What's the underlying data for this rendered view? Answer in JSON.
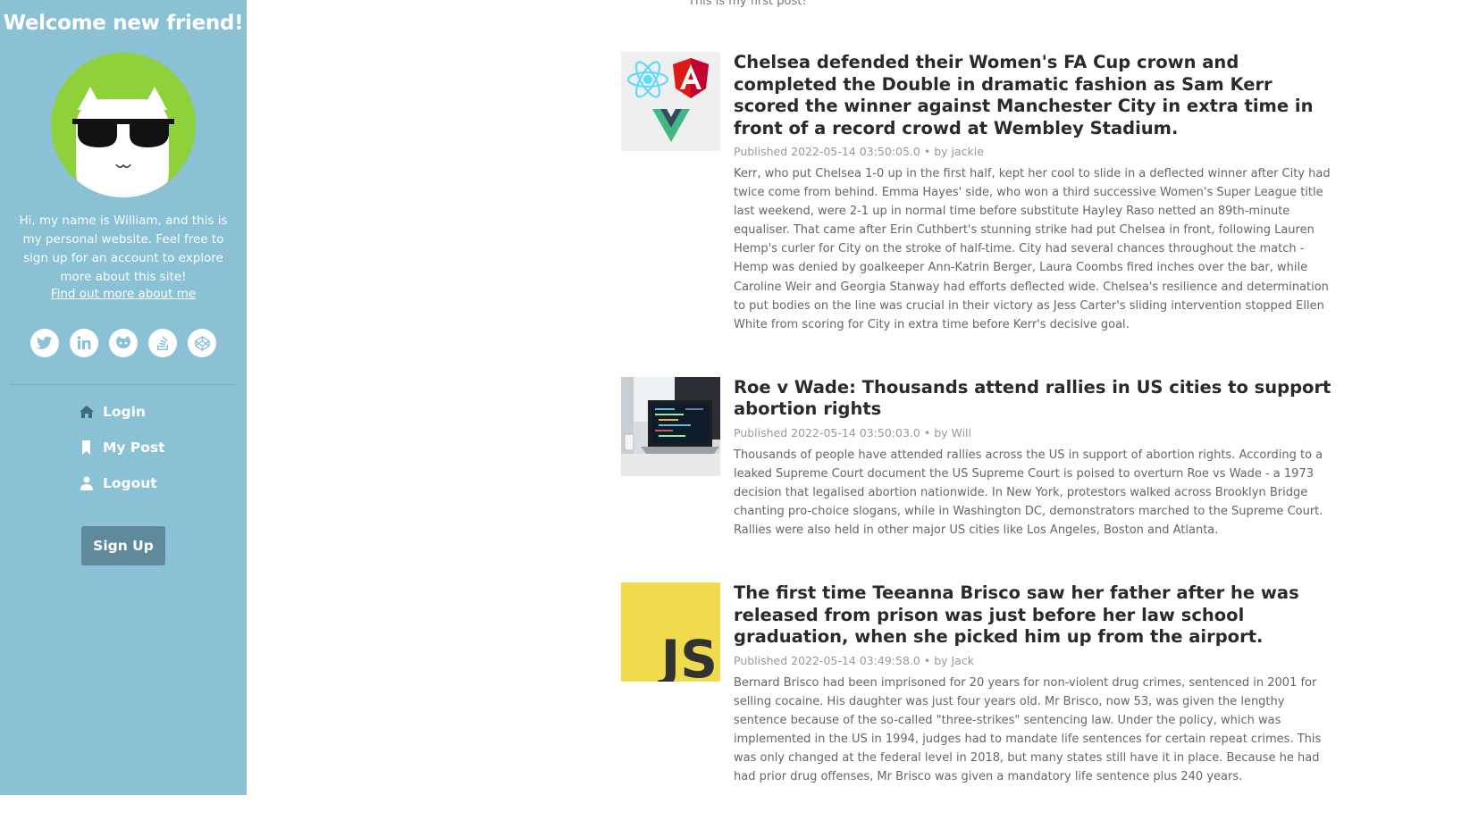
{
  "sidebar": {
    "welcome": "Welcome new friend!",
    "bio": "Hi, my name is William, and this is my personal website. Feel free to sign up for an account to explore more about this site!",
    "about_link": "Find out more about me",
    "socials": [
      "twitter-icon",
      "linkedin-icon",
      "github-icon",
      "stackoverflow-icon",
      "codepen-icon"
    ],
    "nav": [
      {
        "label": "Login",
        "icon": "home-icon"
      },
      {
        "label": "My Post",
        "icon": "bookmark-icon"
      },
      {
        "label": "Logout",
        "icon": "user-icon"
      }
    ],
    "signup_label": "Sign Up",
    "bg_color": "#8ac1d5",
    "button_color": "#5f8a9b"
  },
  "top_snippet": "This is my first post!",
  "posts": [
    {
      "title": "Chelsea defended their Women's FA Cup crown and completed the Double in dramatic fashion as Sam Kerr scored the winner against Manchester City in extra time in front of a record crowd at Wembley Stadium.",
      "published": "Published 2022-05-14 03:50:05.0",
      "author": "by jackie",
      "excerpt": "Kerr, who put Chelsea 1-0 up in the first half, kept her cool to slide in a deflected winner after City had twice come from behind. Emma Hayes' side, who won a third successive Women's Super League title last weekend, were 2-1 up in normal time before substitute Hayley Raso netted an 89th-minute equaliser. That came after Erin Cuthbert's stunning strike had put Chelsea in front, following Lauren Hemp's curler for City on the stroke of half-time. City had several chances throughout the match - Hemp was denied by goalkeeper Ann-Katrin Berger, Laura Coombs fired inches over the bar, while Caroline Weir and Georgia Stanway had efforts deflected wide. Chelsea's resilience and determination to put bodies on the line was crucial in their victory as Jess Carter's sliding intervention stopped Ellen White from scoring for City in extra time before Kerr's decisive goal.",
      "thumb": "frameworks"
    },
    {
      "title": "Roe v Wade: Thousands attend rallies in US cities to support abortion rights",
      "published": "Published 2022-05-14 03:50:03.0",
      "author": "by Will",
      "excerpt": "Thousands of people have attended rallies across the US in support of abortion rights. According to a leaked Supreme Court document the US Supreme Court is poised to overturn Roe vs Wade - a 1973 decision that legalised abortion nationwide. In New York, protestors walked across Brooklyn Bridge chanting pro-choice slogans, while in Washington DC, demonstrators marched to the Supreme Court. Rallies were also held in other major US cities like Los Angeles, Boston and Atlanta.",
      "thumb": "laptop"
    },
    {
      "title": "The first time Teeanna Brisco saw her father after he was released from prison was just before her law school graduation, when she picked him up from the airport.",
      "published": "Published 2022-05-14 03:49:58.0",
      "author": "by Jack",
      "excerpt": "Bernard Brisco had been imprisoned for 20 years for non-violent drug crimes, sentenced in 2001 for selling cocaine. His daughter was just four years old. Mr Brisco, now 53, was given the lengthy sentence because of the so-called \"three-strikes\" sentencing law. Under the policy, which was implemented in the US in 1994, judges had to mandate life sentences for certain repeat crimes. This was only changed at the federal level in 2018, but many states still have it in place. Because he had had prior drug offenses, Mr Brisco was given a mandatory life sentence plus 240 years.",
      "thumb": "js",
      "thumb_text": "JS"
    }
  ]
}
